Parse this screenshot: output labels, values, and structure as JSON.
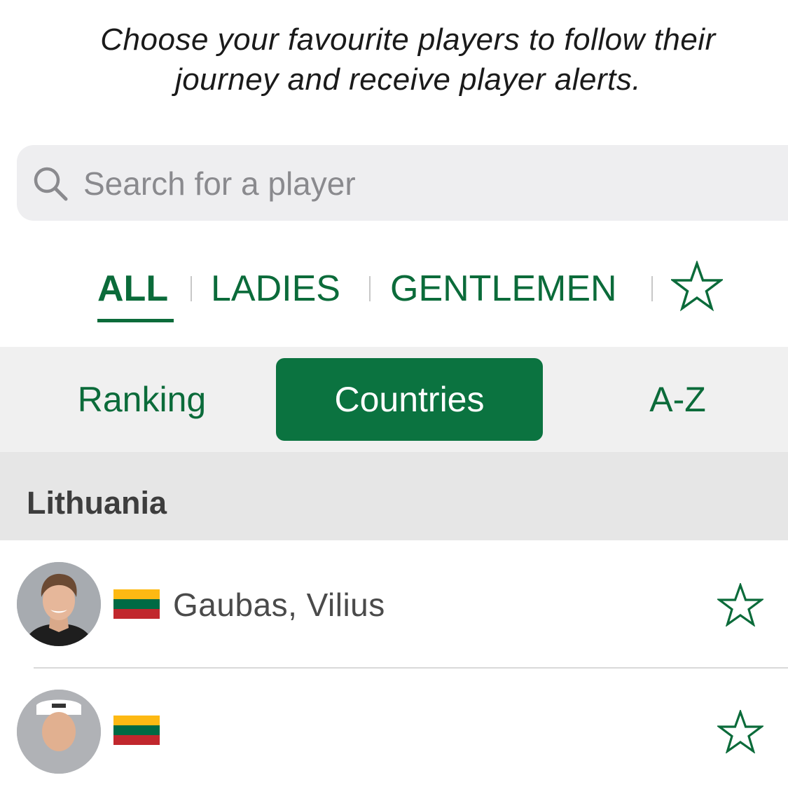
{
  "intro": {
    "line1": "Choose your favourite players to follow their",
    "line2": "journey and receive player alerts."
  },
  "search": {
    "placeholder": "Search for a player",
    "icon": "search-icon"
  },
  "tabs": {
    "items": [
      {
        "label": "ALL",
        "active": true
      },
      {
        "label": "LADIES",
        "active": false
      },
      {
        "label": "GENTLEMEN",
        "active": false
      }
    ],
    "favourites_icon": "star-outline-icon"
  },
  "segment": {
    "items": [
      {
        "label": "Ranking",
        "selected": false
      },
      {
        "label": "Countries",
        "selected": true
      },
      {
        "label": "A-Z",
        "selected": false
      }
    ]
  },
  "section": {
    "title": "Lithuania"
  },
  "players": [
    {
      "name": "Gaubas, Vilius",
      "flag": "lithuania-flag",
      "favourite": false
    },
    {
      "name": "",
      "flag": "lithuania-flag",
      "favourite": false
    }
  ],
  "colors": {
    "accent": "#0b6b3a",
    "segment_selected_bg": "#0b7340",
    "flag_yellow": "#FDB913",
    "flag_green": "#006A44",
    "flag_red": "#C1272D"
  }
}
